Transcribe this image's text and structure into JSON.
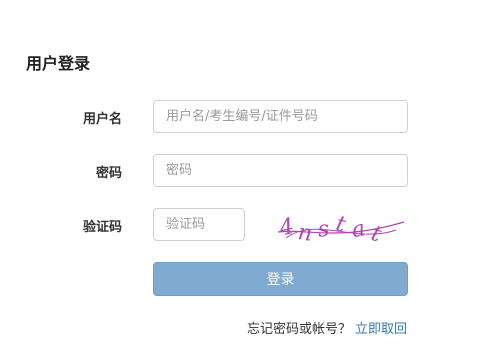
{
  "form": {
    "title": "用户登录",
    "username": {
      "label": "用户名",
      "value": "",
      "placeholder": "用户名/考生编号/证件号码"
    },
    "password": {
      "label": "密码",
      "value": "",
      "placeholder": "密码"
    },
    "captcha": {
      "label": "验证码",
      "value": "",
      "placeholder": "验证码",
      "image_text": "4nstat"
    },
    "submit_label": "登录",
    "forgot": {
      "text": "忘记密码或帐号？",
      "link": "立即取回"
    }
  },
  "colors": {
    "button_bg": "#7faad1",
    "link": "#2f78bc",
    "captcha_ink": "#b23fb6"
  }
}
